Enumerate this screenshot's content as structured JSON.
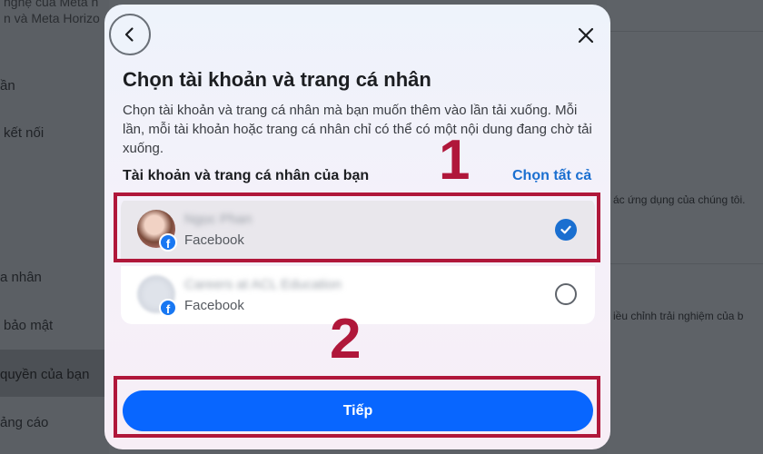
{
  "background": {
    "left_items": [
      "nghệ của Meta n",
      "n và Meta Horizo",
      "ần",
      "kết nối",
      "a nhân",
      "bảo mật",
      "quyền của bạn",
      "ảng cáo"
    ],
    "right_texts": [
      "ác ứng dụng của chúng tôi.",
      "iều chỉnh trải nghiệm của b"
    ]
  },
  "modal": {
    "title": "Chọn tài khoản và trang cá nhân",
    "description": "Chọn tài khoản và trang cá nhân mà bạn muốn thêm vào lần tải xuống. Mỗi lần, mỗi tài khoản hoặc trang cá nhân chỉ có thể có một nội dung đang chờ tải xuống.",
    "section_label": "Tài khoản và trang cá nhân của bạn",
    "select_all": "Chọn tất cả",
    "accounts": [
      {
        "name": "Ngọc Phan",
        "type": "Facebook",
        "selected": true
      },
      {
        "name": "Careers at ACL Education",
        "type": "Facebook",
        "selected": false
      }
    ],
    "next_button": "Tiếp"
  },
  "annotations": {
    "step1": "1",
    "step2": "2",
    "color": "#b0173a"
  },
  "colors": {
    "accent": "#1a6fd0",
    "button": "#0866ff",
    "facebook": "#1877f2"
  },
  "icons": {
    "back": "chevron-left-icon",
    "close": "close-icon",
    "facebook": "facebook-icon",
    "checked": "check-circle-icon",
    "unchecked": "radio-empty-icon"
  }
}
